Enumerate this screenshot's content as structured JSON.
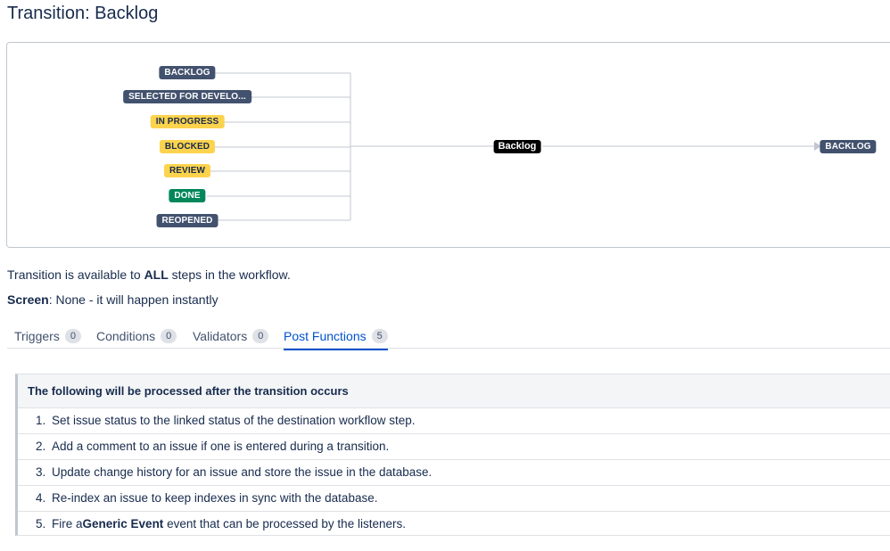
{
  "page": {
    "title": "Transition: Backlog"
  },
  "diagram": {
    "from_statuses": [
      {
        "label": "BACKLOG",
        "color": "blue"
      },
      {
        "label": "SELECTED FOR DEVELO...",
        "color": "blue"
      },
      {
        "label": "IN PROGRESS",
        "color": "yellow"
      },
      {
        "label": "BLOCKED",
        "color": "yellow"
      },
      {
        "label": "REVIEW",
        "color": "yellow"
      },
      {
        "label": "DONE",
        "color": "green"
      },
      {
        "label": "REOPENED",
        "color": "blue"
      }
    ],
    "transition_label": "Backlog",
    "to_status": {
      "label": "BACKLOG",
      "color": "blue"
    }
  },
  "info": {
    "availability_prefix": "Transition is available to ",
    "availability_bold": "ALL",
    "availability_suffix": " steps in the workflow.",
    "screen_label": "Screen",
    "screen_value": ": None - it will happen instantly"
  },
  "tabs": [
    {
      "label": "Triggers",
      "count": "0",
      "active": false
    },
    {
      "label": "Conditions",
      "count": "0",
      "active": false
    },
    {
      "label": "Validators",
      "count": "0",
      "active": false
    },
    {
      "label": "Post Functions",
      "count": "5",
      "active": true
    }
  ],
  "post_functions": {
    "header": "The following will be processed after the transition occurs",
    "items": [
      {
        "num": "1.",
        "pre": "Set issue status to the linked status of the destination workflow step.",
        "bold": "",
        "post": ""
      },
      {
        "num": "2.",
        "pre": "Add a comment to an issue if one is entered during a transition.",
        "bold": "",
        "post": ""
      },
      {
        "num": "3.",
        "pre": "Update change history for an issue and store the issue in the database.",
        "bold": "",
        "post": ""
      },
      {
        "num": "4.",
        "pre": "Re-index an issue to keep indexes in sync with the database.",
        "bold": "",
        "post": ""
      },
      {
        "num": "5.",
        "pre": "Fire a ",
        "bold": "Generic Event",
        "post": " event that can be processed by the listeners."
      }
    ]
  },
  "colors": {
    "blue": "#42526e",
    "yellow": "#fcd34d",
    "green": "#00875a",
    "link": "#0052cc"
  }
}
